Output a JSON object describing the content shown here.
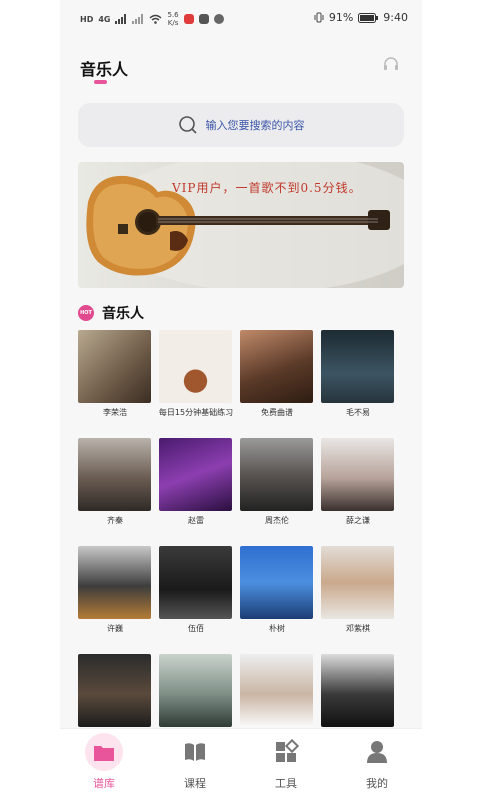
{
  "status_bar": {
    "network": "HD",
    "signal1": "4G",
    "netspeed_value": "5.6",
    "netspeed_unit": "K/s",
    "battery": "91%",
    "time": "9:40"
  },
  "header": {
    "title": "音乐人"
  },
  "search": {
    "placeholder": "输入您要搜索的内容"
  },
  "banner": {
    "text": "VIP用户，一首歌不到0.5分钱。"
  },
  "section": {
    "badge": "HOT",
    "title": "音乐人"
  },
  "musicians": [
    {
      "name": "李荣浩"
    },
    {
      "name": "每日15分钟基础练习"
    },
    {
      "name": "免费曲谱"
    },
    {
      "name": "毛不易"
    },
    {
      "name": "齐秦"
    },
    {
      "name": "赵雷"
    },
    {
      "name": "周杰伦"
    },
    {
      "name": "薛之谦"
    },
    {
      "name": "许巍"
    },
    {
      "name": "伍佰"
    },
    {
      "name": "朴树"
    },
    {
      "name": "邓紫棋"
    },
    {
      "name": ""
    },
    {
      "name": ""
    },
    {
      "name": ""
    },
    {
      "name": ""
    }
  ],
  "tabbar": {
    "tabs": [
      {
        "label": "谱库",
        "active": true
      },
      {
        "label": "课程",
        "active": false
      },
      {
        "label": "工具",
        "active": false
      },
      {
        "label": "我的",
        "active": false
      }
    ]
  },
  "colors": {
    "accent": "#e8559a",
    "search_text": "#3b56a8",
    "banner_text": "#c0392b"
  }
}
